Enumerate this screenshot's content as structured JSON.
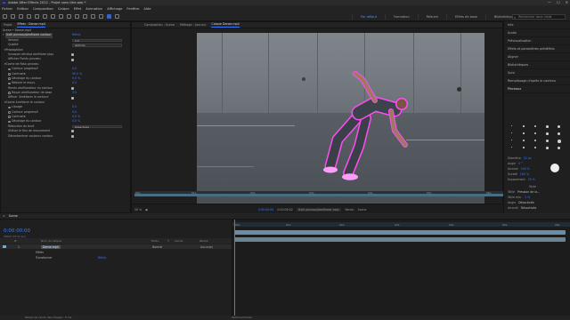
{
  "app": {
    "title": "Adobe After Effects 2022 - Projet sans titre.aep *",
    "logo": "Ae",
    "window_controls": [
      "—",
      "☐",
      "✕"
    ]
  },
  "menu": [
    "Fichier",
    "Edition",
    "Composition",
    "Calque",
    "Effet",
    "Animation",
    "Affichage",
    "Fenêtre",
    "Aide"
  ],
  "workspaces": [
    "Par défaut",
    "Formation",
    "Réduire",
    "Effets de base",
    "Bibliothèques"
  ],
  "search_placeholder": "Rechercher dans l'aide",
  "project_panel": {
    "tabs": [
      "Projet",
      "Effets : Danse.mp4"
    ],
    "layer_breadcrumb": "Scene • Danse.mp4",
    "effect_name": "Outil pinceau/Améliorer contour",
    "reset_label": "Réinit.",
    "rows": [
      {
        "label": "Version",
        "value": "2.0",
        "kind": "dd"
      },
      {
        "label": "Qualité",
        "value": "Optimal",
        "kind": "dd"
      },
      {
        "label": "Propagation",
        "value": "",
        "kind": "group"
      },
      {
        "label": "Invoquer attribut améliorer piqu",
        "value": "",
        "kind": "chk"
      },
      {
        "label": "Afficher Points pinceau",
        "value": "",
        "kind": "chk"
      },
      {
        "label": "Cache de Roto pinceau",
        "value": "",
        "kind": "group"
      },
      {
        "label": "Contour progressif",
        "value": "0,0",
        "kind": "val"
      },
      {
        "label": "Contraste",
        "value": "90,0 %",
        "kind": "val"
      },
      {
        "label": "Décalage du contour",
        "value": "0,0 %",
        "kind": "val"
      },
      {
        "label": "Réduire le mouv.",
        "value": "0,0",
        "kind": "val"
      },
      {
        "label": "Rendu améliorateur du contour",
        "value": "",
        "kind": "chk"
      },
      {
        "label": "Rayon améliorateur de base",
        "value": "3,0",
        "kind": "val"
      },
      {
        "label": "Affiner 'Améliorer le contour'",
        "value": "",
        "kind": "chk"
      },
      {
        "label": "Cache Améliorer le contour",
        "value": "",
        "kind": "group"
      },
      {
        "label": "Lissage",
        "value": "0,0",
        "kind": "val"
      },
      {
        "label": "Contour progressif",
        "value": "0,0",
        "kind": "val"
      },
      {
        "label": "Contraste",
        "value": "0,0 %",
        "kind": "val"
      },
      {
        "label": "Décalage du contour",
        "value": "0,0 %",
        "kind": "val"
      },
      {
        "label": "Réduction du bruit",
        "value": "Désactivée",
        "kind": "dd"
      },
      {
        "label": "Utiliser le flou de mouvement",
        "value": "",
        "kind": "chk"
      },
      {
        "label": "Décontaminer couleurs contour",
        "value": "",
        "kind": "chk"
      }
    ]
  },
  "composition": {
    "tabs": [
      "Composition : Scene",
      "Métrage : (aucun)",
      "Calque Danse.mp4"
    ],
    "zoom": "50 %",
    "time": "0:00:00:00",
    "duration": "0:00:06:02",
    "preview_mode": "Outil pinceau/Améliorer cont.",
    "render_label": "Rendu",
    "toggle_label": "Scene",
    "ruler": [
      "00s",
      "01s",
      "02s",
      "03s",
      "04s",
      "05s",
      "06s"
    ]
  },
  "right_panel": {
    "items": [
      "Info",
      "Audio",
      "Prévisualisation",
      "Effets et paramètres prédéfinis",
      "Aligner",
      "Bibliothèques",
      "Suivi",
      "Remplissage d'après le contenu",
      "Pinceaux"
    ],
    "brush": {
      "diameter_label": "Diamètre",
      "diameter": "21 px",
      "angle_label": "Angle",
      "angle": "0 °",
      "round_label": "Arrondi",
      "round": "100 %",
      "hard_label": "Dureté",
      "hard": "100 %",
      "spacing_label": "Espacement",
      "spacing": "25 %",
      "style_label": "Style",
      "size_label": "Taille",
      "size": "Pression de la...",
      "minsize_label": "Taille min.",
      "minsize": "1 %",
      "angle2_label": "Angle",
      "angle2": "Désactivée",
      "round2_label": "Arrondi",
      "round2": "Désactivée",
      "opacity_label": "Opacité",
      "opacity": "Désactivée",
      "flow_label": "Flux",
      "flow": "Désactivée",
      "footer": "Paragraphe"
    }
  },
  "timeline": {
    "tab": "Scene",
    "time": "0:00:00:00",
    "fps": "00000 (25.00 ips)",
    "columns": [
      "N°",
      "Nom du calque",
      "Mode",
      "T",
      "Cache",
      "Parent"
    ],
    "layers": [
      {
        "num": "1",
        "name": "Danse.mp4",
        "mode": "Normal",
        "parent": "Aucun(e)"
      },
      {
        "name": "Effets"
      },
      {
        "name": "Transformer",
        "value": "Réinit."
      }
    ],
    "ruler": [
      "00s",
      "01s",
      "02s",
      "03s",
      "04s",
      "05s",
      "06s"
    ]
  },
  "statusbar": {
    "left": "Temps de rendu des images : 0 ms",
    "right": "Options/modes"
  }
}
